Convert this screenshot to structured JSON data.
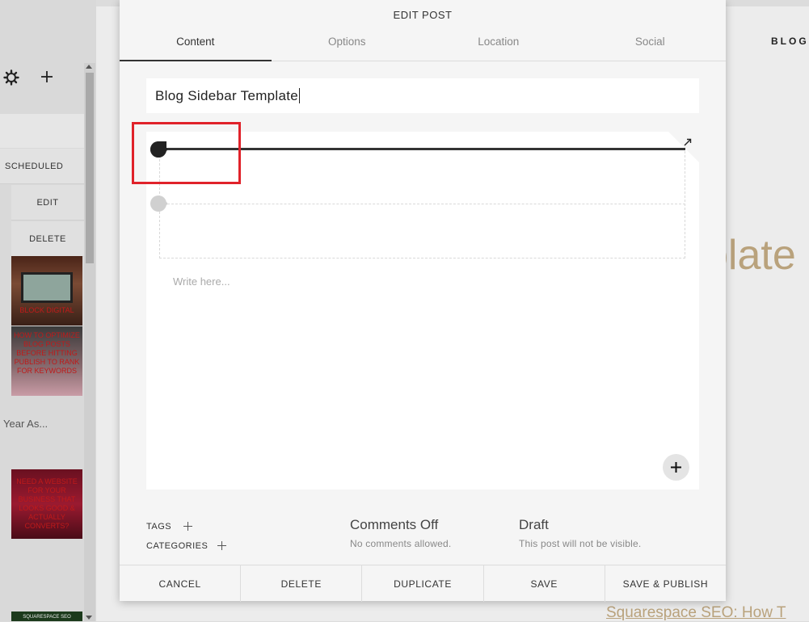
{
  "background": {
    "nav_link": "BLOG",
    "heading_fragment": "plate",
    "post_title_fragment": "Squarespace SEO: How T"
  },
  "left_panel": {
    "status_label": "SCHEDULED",
    "edit_label": "EDIT",
    "delete_label": "DELETE",
    "thumbs": [
      {
        "text": "BLOCK DIGITAL"
      },
      {
        "text": "HOW TO OPTIMIZE BLOG POSTS BEFORE HITTING PUBLISH TO RANK FOR KEYWORDS"
      },
      {
        "text": "NEED A WEBSITE FOR YOUR BUSINESS THAT LOOKS GOOD & ACTUALLY CONVERTS?"
      },
      {
        "text": "SQUARESPACE SEO"
      }
    ],
    "caption": "Year As..."
  },
  "modal": {
    "title": "EDIT POST",
    "tabs": [
      {
        "label": "Content"
      },
      {
        "label": "Options"
      },
      {
        "label": "Location"
      },
      {
        "label": "Social"
      }
    ],
    "post_title": "Blog Sidebar Template",
    "editor_placeholder": "Write here...",
    "tags_label": "TAGS",
    "categories_label": "CATEGORIES",
    "comments": {
      "title": "Comments Off",
      "subtitle": "No comments allowed."
    },
    "status": {
      "title": "Draft",
      "subtitle": "This post will not be visible."
    },
    "footer": {
      "cancel": "CANCEL",
      "delete": "DELETE",
      "duplicate": "DUPLICATE",
      "save": "SAVE",
      "save_publish": "SAVE & PUBLISH"
    }
  },
  "colors": {
    "highlight": "#e0222a",
    "accent_text": "#b9a27c",
    "modal_bg": "#f5f5f5"
  },
  "icons": [
    "gear-icon",
    "plus-icon",
    "expand-icon",
    "block-handle-icon",
    "add-block-icon"
  ]
}
